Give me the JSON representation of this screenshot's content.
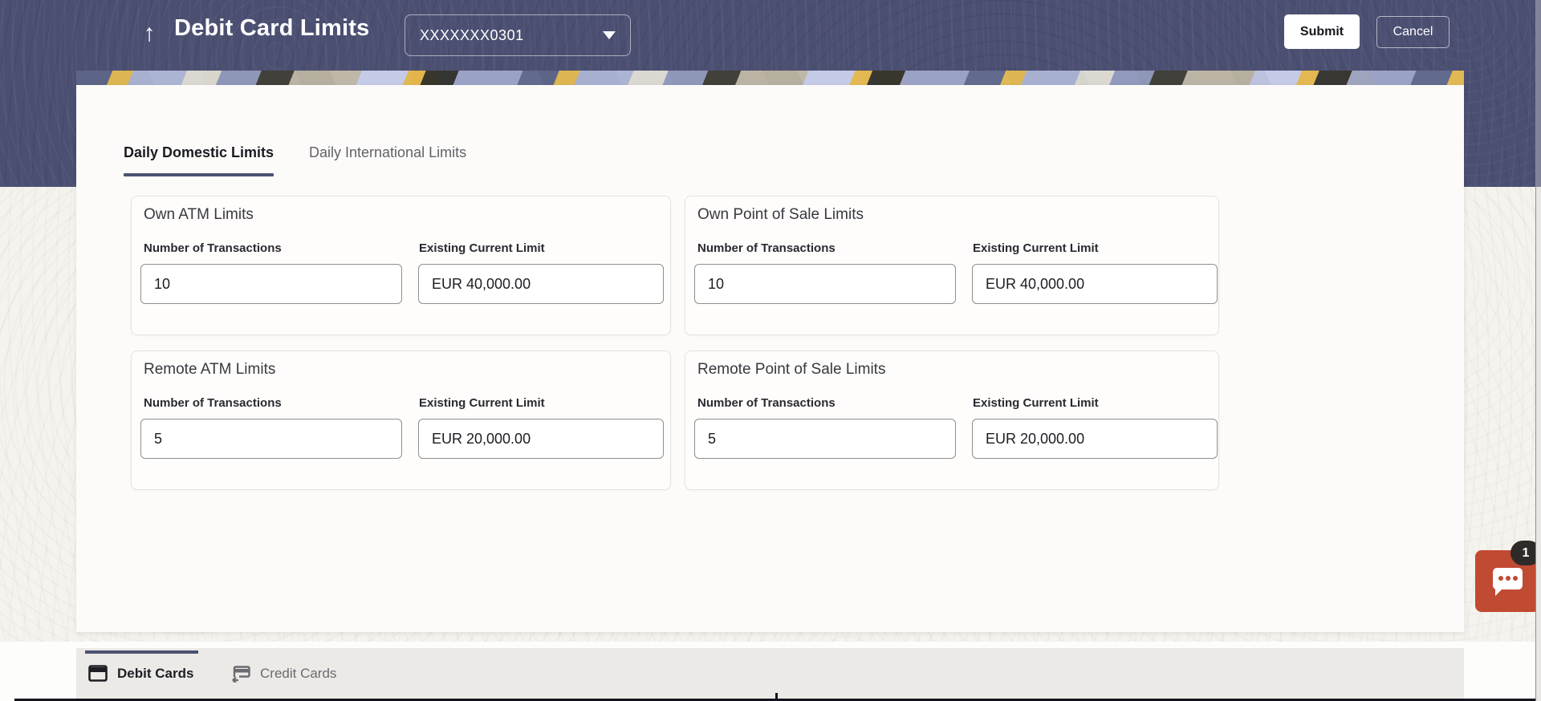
{
  "header": {
    "back_icon": "up-arrow",
    "title": "Debit Card Limits",
    "card_selector": {
      "value": "XXXXXXX0301",
      "caret_icon": "chevron-down"
    },
    "submit_label": "Submit",
    "cancel_label": "Cancel"
  },
  "colors": {
    "hero_bg": "#4b4f71",
    "accent_slate": "#4c5170",
    "panel_bg": "#fcfbf9",
    "chat_fab": "#c14a33",
    "badge_bg": "#2e2a27",
    "bottom_bar_bg": "#eceae7"
  },
  "main": {
    "tabs": [
      {
        "label": "Daily Domestic Limits",
        "active": true
      },
      {
        "label": "Daily International Limits",
        "active": false
      }
    ],
    "cards": [
      {
        "title": "Own ATM Limits",
        "label1": "Number of Transactions",
        "value1": "10",
        "label2": "Existing Current Limit",
        "value2": "EUR 40,000.00"
      },
      {
        "title": "Own Point of Sale Limits",
        "label1": "Number of Transactions",
        "value1": "10",
        "label2": "Existing Current Limit",
        "value2": "EUR 40,000.00"
      },
      {
        "title": "Remote ATM Limits",
        "label1": "Number of Transactions",
        "value1": "5",
        "label2": "Existing Current Limit",
        "value2": "EUR 20,000.00"
      },
      {
        "title": "Remote Point of Sale Limits",
        "label1": "Number of Transactions",
        "value1": "5",
        "label2": "Existing Current Limit",
        "value2": "EUR 20,000.00"
      }
    ]
  },
  "chat": {
    "badge_count": "1",
    "icon": "chat-bubble"
  },
  "footer": {
    "tabs": [
      {
        "label": "Debit Cards",
        "icon": "debit-card",
        "active": true
      },
      {
        "label": "Credit Cards",
        "icon": "credit-card-swap",
        "active": false
      }
    ]
  }
}
